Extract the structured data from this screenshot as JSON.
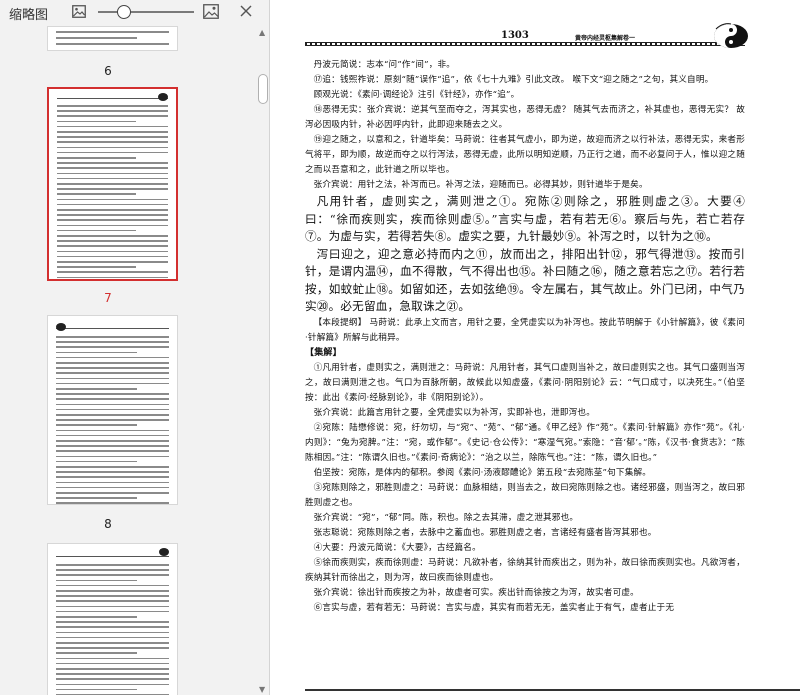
{
  "sidebar": {
    "title": "缩略图",
    "icons": {
      "thumbnail_small": "image-small-icon",
      "thumbnail_large": "image-large-icon",
      "close": "close-icon",
      "slider": "zoom-slider"
    },
    "thumbs": [
      {
        "label": "6",
        "selected": false
      },
      {
        "label": "7",
        "selected": true
      },
      {
        "label": "8",
        "selected": false
      }
    ]
  },
  "page": {
    "page_number": "1303",
    "running_head": "黄帝内经灵枢集解卷一",
    "paragraphs": [
      {
        "style": "small",
        "text": "丹波元简说：志本“问”作“间”，非。"
      },
      {
        "style": "small",
        "text": "⑰追：钱熙祚说：原刻“随”误作“追”，依《七十九难》引此文改。 喉下文“迎之随之”之句，其义自明。"
      },
      {
        "style": "small",
        "text": "顾观光说：《素问·调经论》注引《针经》，亦作“追”。"
      },
      {
        "style": "small",
        "text": "⑱恶得无实：张介宾说：逆其气至而夺之，泻其实也，恶得无虚？ 随其气去而济之，补其虚也，恶得无实？ 故泻必因吸内针，补必因呼内针，此即迎来随去之义。"
      },
      {
        "style": "small",
        "text": "⑲迎之随之，以意和之，针道毕矣：马莳说：往者其气虚小，即为逆，故迎而济之以行补法，恶得无实，来者形气将平，即为顺，故逆而夺之以行泻法，恶得无虚，此所以明知逆顺，乃正行之道，而不必复问于人，惟以迎之随之而以吾意和之，此针道之所以毕也。"
      },
      {
        "style": "small",
        "text": "张介宾说：用针之法，补泻而已。补泻之法，迎随而已。必得其妙，则针道毕于是矣。"
      },
      {
        "style": "big",
        "text": "凡用针者，虚则实之，满则泄之①。宛陈②则除之，邪胜则虚之③。大要④曰：“徐而疾则实，疾而徐则虚⑤。”言实与虚，若有若无⑥。察后与先，若亡若存⑦。为虚与实，若得若失⑧。虚实之要，九针最妙⑨。补泻之时，以针为之⑩。"
      },
      {
        "style": "big",
        "text": "泻曰迎之，迎之意必持而内之⑪，放而出之，排阳出针⑫，邪气得泄⑬。按而引针，是谓内温⑭，血不得散，气不得出也⑮。补曰随之⑯，随之意若忘之⑰。若行若按，如蚊虻止⑱。如留如还，去如弦绝⑲。令左属右，其气故止。外门已闭，中气乃实⑳。必无留血，急取诛之㉑。"
      },
      {
        "style": "small",
        "text": "【本段提纲】 马莳说：此承上文而言，用针之要，全凭虚实以为补泻也。按此节明解于《小针解篇》，彼《素问·针解篇》所解与此稍异。"
      },
      {
        "style": "heading",
        "text": "【集解】"
      },
      {
        "style": "small",
        "text": "①凡用针者，虚则实之，满则泄之：马莳说：凡用针者，其气口虚则当补之，故曰虚则实之也。其气口盛则当泻之，故曰满则泄之也。气口为百脉所朝，故候此以知虚盛，《素问·阴阳别论》云：“气口成寸，以决死生。”（伯坚按：此出《素问·经脉别论》，非《阴阳别论》）。"
      },
      {
        "style": "small",
        "text": "张介宾说：此篇言用针之要，全凭虚实以为补泻，实即补也，泄即泻也。"
      },
      {
        "style": "small",
        "text": "②宛陈：陆懋修说：宛，纡勿切，与“宛”、“苑”、“郁”通。《甲乙经》作“苑”。《素问·针解篇》亦作“苑”。《礼·内则》：“兔为宛脾。”注：“宛，或作郁”。《史记·仓公传》：“寒湿气宛。”索隐：“音‘郁’。”陈，《汉书·食货志》：“陈陈相因。”注：“陈谓久旧也。”《素问·奇病论》：“治之以兰，除陈气也。”注：“陈，谓久旧也。”"
      },
      {
        "style": "small",
        "text": "伯坚按：宛陈，是体内的郁积。参阅《素问·汤液醪醴论》第五段“去宛陈莝”句下集解。"
      },
      {
        "style": "small",
        "text": "③宛陈则除之，邪胜则虚之：马莳说：血脉相结，则当去之，故曰宛陈则除之也。诸经邪盛，则当泻之，故曰邪胜则虚之也。"
      },
      {
        "style": "small",
        "text": "张介宾说：“宛”，“郁”同。陈，积也。除之去其滞，虚之泄其邪也。"
      },
      {
        "style": "small",
        "text": "张志聪说：宛陈则除之者，去脉中之蓄血也。邪胜则虚之者，言诸经有盛者皆泻其邪也。"
      },
      {
        "style": "small",
        "text": "④大要：丹波元简说：《大要》，古经篇名。"
      },
      {
        "style": "small",
        "text": "⑤徐而疾则实，疾而徐则虚：马莳说：凡欲补者，徐纳其针而疾出之，则为补，故曰徐而疾则实也。凡欲泻者，疾纳其针而徐出之，则为泻，故曰疾而徐则虚也。"
      },
      {
        "style": "small",
        "text": "张介宾说：徐出针而疾按之为补，故虚者可实。疾出针而徐按之为泻，故实者可虚。"
      },
      {
        "style": "small",
        "text": "⑥言实与虚，若有若无：马莳说：言实与虚，其实有而若无无，盖实者止于有气，虚者止于无"
      }
    ]
  }
}
